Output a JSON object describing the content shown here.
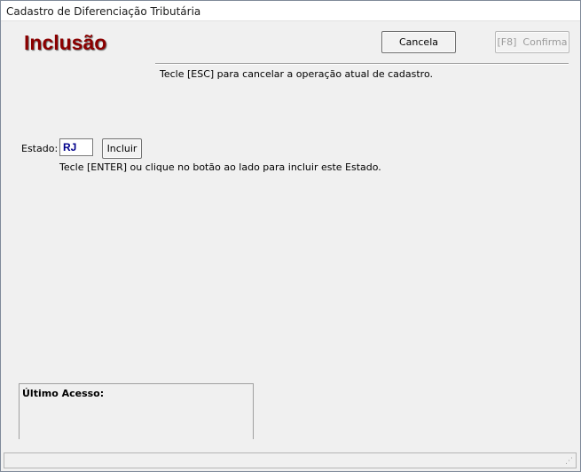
{
  "window": {
    "title": "Cadastro de Diferenciação Tributária"
  },
  "header": {
    "title": "Inclusão",
    "cancel_label": "Cancela",
    "confirm_label": "[F8]  Confirma",
    "esc_hint": "Tecle [ESC] para cancelar a operação atual de cadastro."
  },
  "form": {
    "estado_label": "Estado:",
    "estado_value": "RJ",
    "incluir_label": "Incluir",
    "enter_hint": "Tecle [ENTER] ou clique no botão ao lado para incluir este Estado."
  },
  "footer": {
    "last_access_label": "Último Acesso:",
    "status_text": ""
  }
}
